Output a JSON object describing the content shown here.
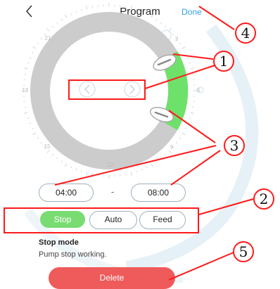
{
  "header": {
    "title": "Program",
    "done_label": "Done"
  },
  "dial": {
    "hour_labels": [
      "21",
      "3",
      "18",
      "6",
      "15",
      "12",
      "9"
    ],
    "active_color": "#6ee16a",
    "track_color": "#cccccc"
  },
  "schedule": {
    "start_time": "04:00",
    "separator": "-",
    "end_time": "08:00"
  },
  "modes": {
    "stop_label": "Stop",
    "auto_label": "Auto",
    "feed_label": "Feed",
    "selected": "Stop"
  },
  "mode_info": {
    "title": "Stop mode",
    "description": "Pump stop working."
  },
  "actions": {
    "delete_label": "Delete"
  },
  "callouts": {
    "labels": [
      "1",
      "2",
      "3",
      "4",
      "5"
    ],
    "color": "#ff1a1a"
  },
  "colors": {
    "accent_blue": "#35a2e0",
    "stop_green": "#79dc72",
    "delete_red": "#ef5a5a"
  }
}
